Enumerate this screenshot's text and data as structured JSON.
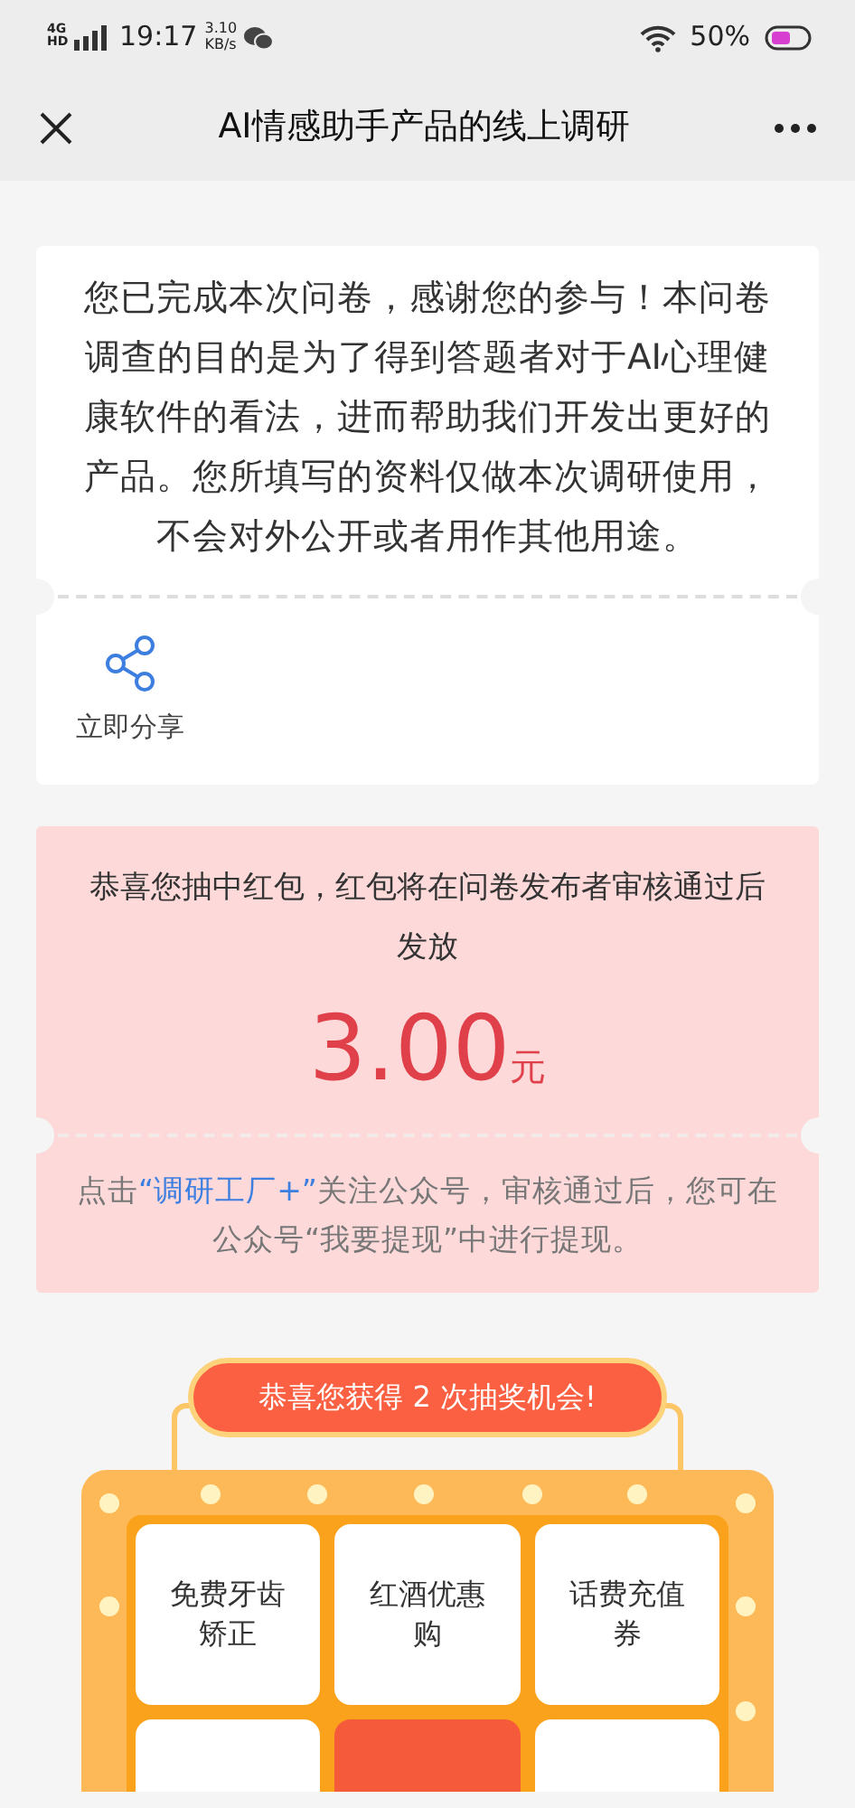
{
  "status_bar": {
    "network": "4G HD",
    "time": "19:17",
    "speed_value": "3.10",
    "speed_unit": "KB/s",
    "battery": "50%"
  },
  "nav": {
    "title": "AI情感助手产品的线上调研"
  },
  "completion": {
    "message": "您已完成本次问卷，感谢您的参与！本问卷调查的目的是为了得到答题者对于AI心理健康软件的看法，进而帮助我们开发出更好的产品。您所填写的资料仅做本次调研使用，不会对外公开或者用作其他用途。",
    "share_label": "立即分享"
  },
  "reward": {
    "message": "恭喜您抽中红包，红包将在问卷发布者审核通过后发放",
    "amount": "3.00",
    "unit": "元",
    "notice_before": "点击",
    "notice_link": "“调研工厂+”",
    "notice_after": "关注公众号，审核通过后，您可在公众号“我要提现”中进行提现。"
  },
  "lottery": {
    "banner": "恭喜您获得 2 次抽奖机会!",
    "prizes": [
      {
        "kind": "prize",
        "label": "免费牙齿矫正"
      },
      {
        "kind": "prize",
        "label": "红酒优惠购"
      },
      {
        "kind": "prize",
        "label": "话费充值券"
      },
      {
        "kind": "prize"
      },
      {
        "kind": "draw"
      },
      {
        "kind": "prize"
      }
    ]
  }
}
